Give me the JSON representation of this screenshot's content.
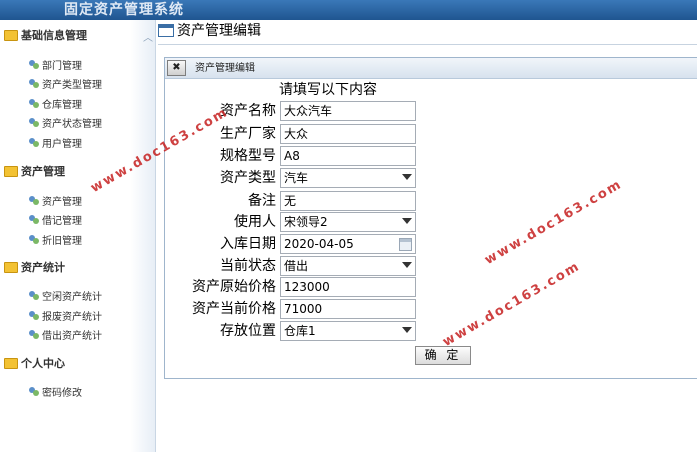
{
  "app": {
    "title": "固定资产管理系统"
  },
  "sidebar": {
    "groups": [
      {
        "label": "基础信息管理",
        "items": [
          {
            "label": "部门管理"
          },
          {
            "label": "资产类型管理"
          },
          {
            "label": "仓库管理"
          },
          {
            "label": "资产状态管理"
          },
          {
            "label": "用户管理"
          }
        ]
      },
      {
        "label": "资产管理",
        "items": [
          {
            "label": "资产管理"
          },
          {
            "label": "借记管理"
          },
          {
            "label": "折旧管理"
          }
        ]
      },
      {
        "label": "资产统计",
        "items": [
          {
            "label": "空闲资产统计"
          },
          {
            "label": "报废资产统计"
          },
          {
            "label": "借出资产统计"
          }
        ]
      },
      {
        "label": "个人中心",
        "items": [
          {
            "label": "密码修改"
          }
        ]
      }
    ]
  },
  "main": {
    "title": "资产管理编辑",
    "panel": {
      "title": "资产管理编辑",
      "heading": "请填写以下内容",
      "fields": [
        {
          "label": "资产名称",
          "value": "大众汽车"
        },
        {
          "label": "生产厂家",
          "value": "大众"
        },
        {
          "label": "规格型号",
          "value": "A8"
        },
        {
          "label": "资产类型",
          "value": "汽车"
        },
        {
          "label": "备注",
          "value": "无"
        },
        {
          "label": "使用人",
          "value": "宋领导2"
        },
        {
          "label": "入库日期",
          "value": "2020-04-05"
        },
        {
          "label": "当前状态",
          "value": "借出"
        },
        {
          "label": "资产原始价格",
          "value": "123000"
        },
        {
          "label": "资产当前价格",
          "value": "71000"
        },
        {
          "label": "存放位置",
          "value": "仓库1"
        }
      ],
      "submit_label": "确 定"
    }
  },
  "watermark": {
    "text": "www.doc163.com"
  },
  "colors": {
    "topbar": "#1f5590",
    "folder": "#f3c233",
    "watermark": "#c62020"
  }
}
